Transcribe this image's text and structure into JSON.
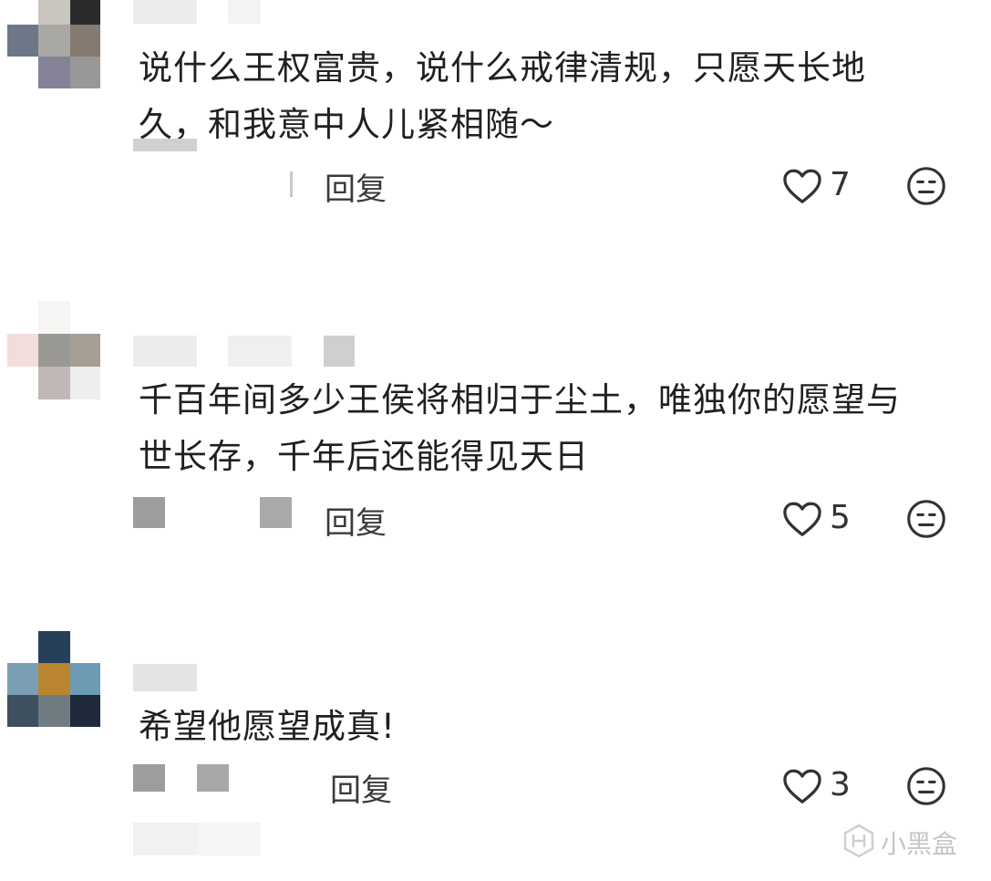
{
  "comments": [
    {
      "text_line1": "说什么王权富贵，说什么戒律清规，只愿天长地",
      "text_line2": "久，和我意中人儿紧相随～",
      "reply_label": "回复",
      "likes": "7"
    },
    {
      "text_line1": "千百年间多少王侯将相归于尘土，唯独你的愿望与",
      "text_line2": "世长存，千年后还能得见天日",
      "reply_label": "回复",
      "likes": "5"
    },
    {
      "text_line1": "希望他愿望成真!",
      "text_line2": "",
      "reply_label": "回复",
      "likes": "3"
    }
  ],
  "watermark": "小黑盒",
  "icons": {
    "like": "heart-outline-icon",
    "react": "neutral-face-icon",
    "watermark": "heybox-logo-icon"
  }
}
